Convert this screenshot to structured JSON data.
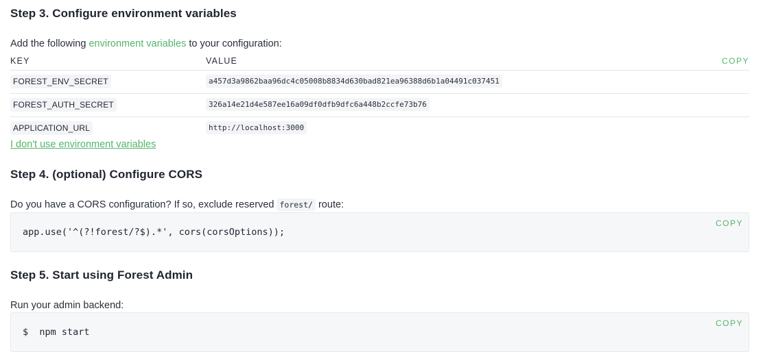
{
  "step3": {
    "title": "Step 3. Configure environment variables",
    "intro_prefix": "Add the following ",
    "intro_link": "environment variables",
    "intro_suffix": " to your configuration:",
    "table": {
      "header_key": "KEY",
      "header_value": "VALUE",
      "copy_label": "COPY",
      "rows": [
        {
          "key": "FOREST_ENV_SECRET",
          "value": "a457d3a9862baa96dc4c05008b8834d630bad821ea96388d6b1a04491c037451"
        },
        {
          "key": "FOREST_AUTH_SECRET",
          "value": "326a14e21d4e587ee16a09df0dfb9dfc6a448b2ccfe73b76"
        },
        {
          "key": "APPLICATION_URL",
          "value": "http://localhost:3000"
        }
      ]
    },
    "no_env_link": "I don't use environment variables"
  },
  "step4": {
    "title": "Step 4. (optional) Configure CORS",
    "intro_prefix": "Do you have a CORS configuration? If so, exclude reserved ",
    "intro_code": "forest/",
    "intro_suffix": " route:",
    "code": "app.use('^(?!forest/?$).*', cors(corsOptions));",
    "copy_label": "COPY"
  },
  "step5": {
    "title": "Step 5. Start using Forest Admin",
    "intro": "Run your admin backend:",
    "code": "$  npm start",
    "copy_label": "COPY"
  },
  "colors": {
    "accent": "#53b56a",
    "text": "#1f2430",
    "code_bg": "#f6f7f9",
    "border": "#e3e5ea"
  }
}
